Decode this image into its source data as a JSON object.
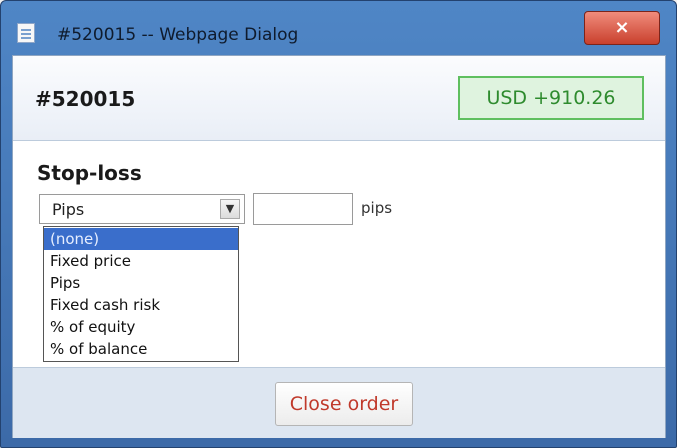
{
  "window": {
    "title": "#520015 -- Webpage Dialog",
    "close_glyph": "×"
  },
  "header": {
    "order_id": "#520015",
    "pnl": "USD +910.26"
  },
  "stop_loss": {
    "heading": "Stop-loss",
    "selected": "Pips",
    "arrow_glyph": "▼",
    "value": "",
    "unit": "pips",
    "options": [
      {
        "label": "(none)",
        "highlighted": true
      },
      {
        "label": "Fixed price",
        "highlighted": false
      },
      {
        "label": "Pips",
        "highlighted": false
      },
      {
        "label": "Fixed cash risk",
        "highlighted": false
      },
      {
        "label": "% of equity",
        "highlighted": false
      },
      {
        "label": "% of balance",
        "highlighted": false
      }
    ]
  },
  "footer": {
    "close_order_label": "Close order"
  },
  "colors": {
    "highlight": "#3a6ecb",
    "profit": "#2e8b2e",
    "action_text": "#c0392b"
  }
}
